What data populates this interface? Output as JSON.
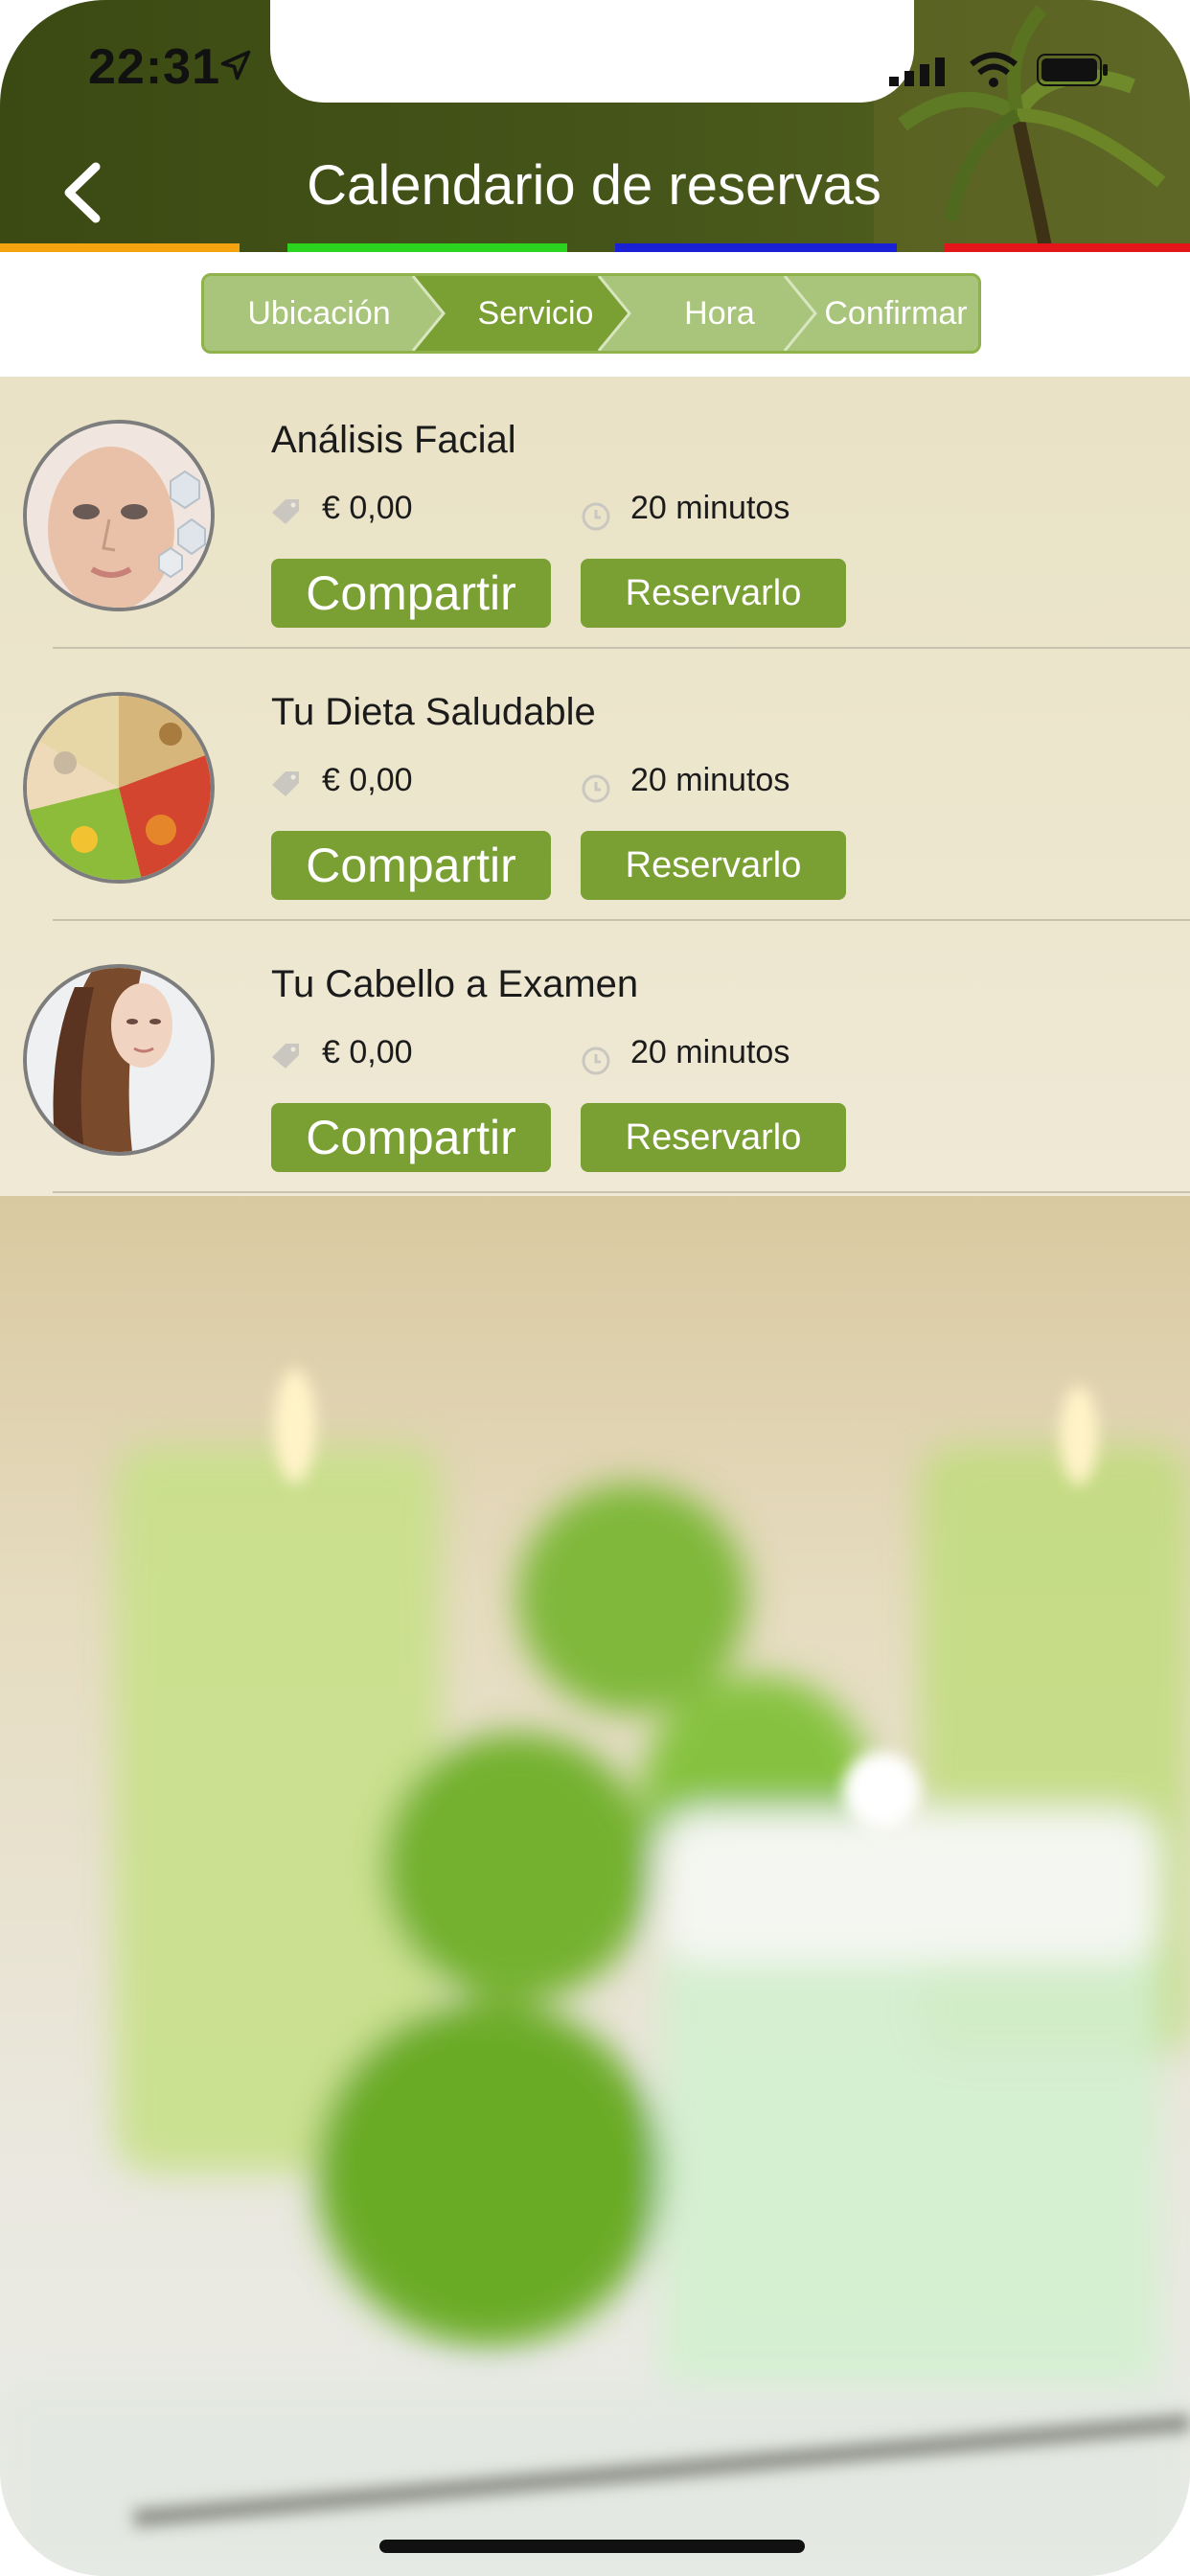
{
  "status_bar": {
    "time": "22:31"
  },
  "header": {
    "title": "Calendario de reservas",
    "accent_colors": [
      "#f5a30f",
      "#2ad41f",
      "#1a20d6",
      "#e5161a"
    ]
  },
  "stepper": {
    "steps": [
      {
        "label": "Ubicación"
      },
      {
        "label": "Servicio"
      },
      {
        "label": "Hora"
      },
      {
        "label": "Confirmar"
      }
    ],
    "active_index": 1,
    "colors": {
      "active": "#7a9f33",
      "inactive": "#a9c57b"
    }
  },
  "services": [
    {
      "name": "Análisis Facial",
      "price": "€ 0,00",
      "duration": "20 minutos",
      "share_label": "Compartir",
      "book_label": "Reservarlo"
    },
    {
      "name": "Tu Dieta Saludable",
      "price": "€ 0,00",
      "duration": "20 minutos",
      "share_label": "Compartir",
      "book_label": "Reservarlo"
    },
    {
      "name": "Tu Cabello a Examen",
      "price": "€ 0,00",
      "duration": "20 minutos",
      "share_label": "Compartir",
      "book_label": "Reservarlo"
    }
  ],
  "icons": [
    "back-chevron-icon",
    "location-arrow-icon",
    "signal-icon",
    "wifi-icon",
    "battery-icon",
    "price-tag-icon",
    "clock-icon"
  ]
}
